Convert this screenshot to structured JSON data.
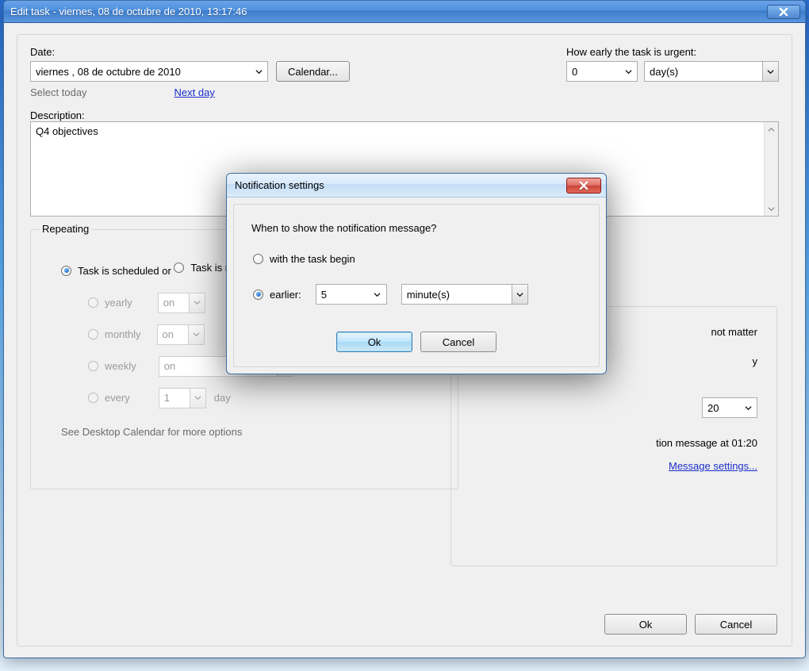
{
  "window": {
    "title": "Edit task - viernes, 08 de octubre de 2010, 13:17:46"
  },
  "date": {
    "label": "Date:",
    "value": "viernes , 08 de   octubre    de 2010",
    "calendar_btn": "Calendar...",
    "select_today": "Select today",
    "next_day": "Next day"
  },
  "urgent": {
    "label": "How early the task is urgent:",
    "value": "0",
    "unit": "day(s)"
  },
  "description": {
    "label": "Description:",
    "value": "Q4 objectives"
  },
  "repeating": {
    "title": "Repeating",
    "opt_once": "Task is scheduled or",
    "opt_repeated": "Task is repeated",
    "yearly": "yearly",
    "monthly": "monthly",
    "weekly": "weekly",
    "every": "every",
    "spin_value": "1",
    "spin_unit": "day",
    "on1": "on",
    "on2": "on",
    "on3": "on",
    "more": "See Desktop Calendar for more options"
  },
  "right_panel": {
    "not_matter": "not matter",
    "y_suffix": "y",
    "time_value": "20",
    "msg_tail": "tion message at 01:20",
    "settings_link": "Message settings..."
  },
  "main_buttons": {
    "ok": "Ok",
    "cancel": "Cancel"
  },
  "modal": {
    "title": "Notification settings",
    "question": "When to show the notification message?",
    "opt_begin": "with the task begin",
    "opt_earlier": "earlier:",
    "amount": "5",
    "unit": "minute(s)",
    "ok": "Ok",
    "cancel": "Cancel"
  }
}
